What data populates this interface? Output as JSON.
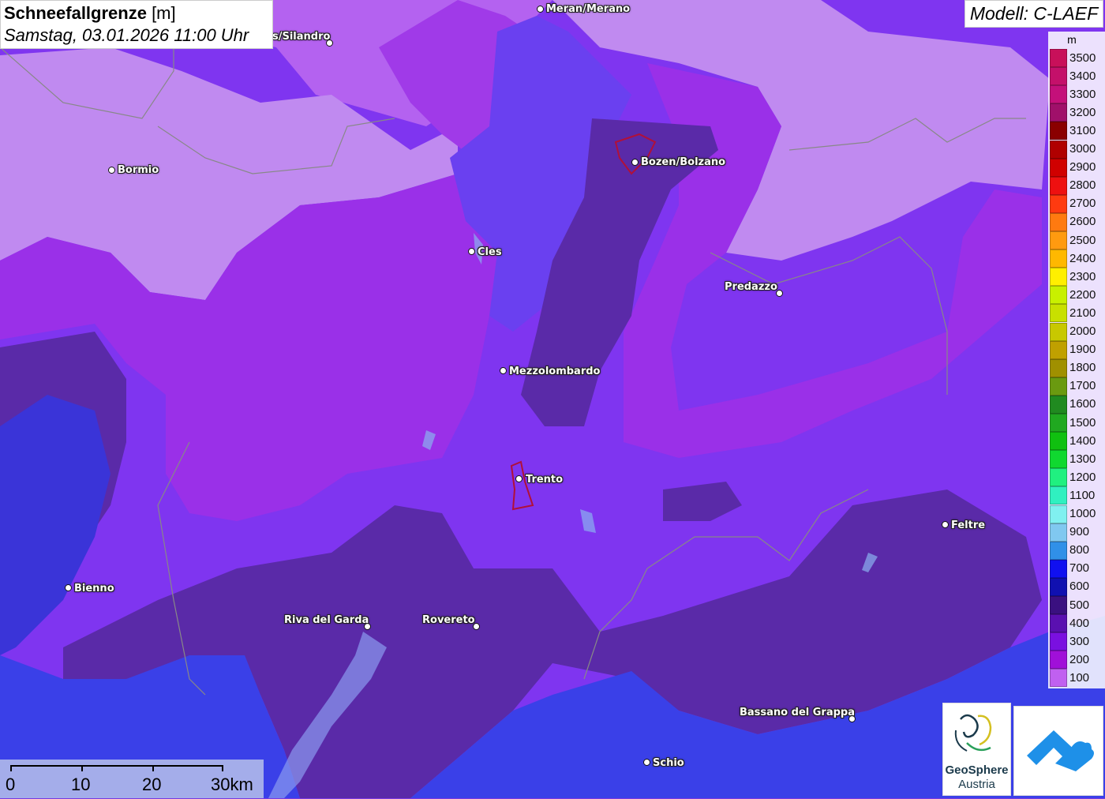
{
  "title": {
    "main": "Schneefallgrenze",
    "unit": " [m]",
    "date": "Samstag, 03.01.2026 11:00 Uhr"
  },
  "model": "Modell: C-LAEF",
  "legend": {
    "unit": "m",
    "items": [
      {
        "label": "3500",
        "color": "#c8105a"
      },
      {
        "label": "3400",
        "color": "#c4106a"
      },
      {
        "label": "3300",
        "color": "#c4107a"
      },
      {
        "label": "3200",
        "color": "#a0106a"
      },
      {
        "label": "3100",
        "color": "#8a0000"
      },
      {
        "label": "3000",
        "color": "#b00000"
      },
      {
        "label": "2900",
        "color": "#d00000"
      },
      {
        "label": "2800",
        "color": "#ee1010"
      },
      {
        "label": "2700",
        "color": "#ff3a10"
      },
      {
        "label": "2600",
        "color": "#ff7a10"
      },
      {
        "label": "2500",
        "color": "#ff9a10"
      },
      {
        "label": "2400",
        "color": "#ffb800"
      },
      {
        "label": "2300",
        "color": "#ffef00"
      },
      {
        "label": "2200",
        "color": "#c8f000"
      },
      {
        "label": "2100",
        "color": "#c8e000"
      },
      {
        "label": "2000",
        "color": "#c8c800"
      },
      {
        "label": "1900",
        "color": "#c0a000"
      },
      {
        "label": "1800",
        "color": "#a09000"
      },
      {
        "label": "1700",
        "color": "#6a9a10"
      },
      {
        "label": "1600",
        "color": "#208a20"
      },
      {
        "label": "1500",
        "color": "#20a820"
      },
      {
        "label": "1400",
        "color": "#10c010"
      },
      {
        "label": "1300",
        "color": "#10d830"
      },
      {
        "label": "1200",
        "color": "#20f080"
      },
      {
        "label": "1100",
        "color": "#30f0c0"
      },
      {
        "label": "1000",
        "color": "#80f0f0"
      },
      {
        "label": "900",
        "color": "#80c8f0"
      },
      {
        "label": "800",
        "color": "#3090e8"
      },
      {
        "label": "700",
        "color": "#1010f0"
      },
      {
        "label": "600",
        "color": "#1010b0"
      },
      {
        "label": "500",
        "color": "#3a1080"
      },
      {
        "label": "400",
        "color": "#5a10b0"
      },
      {
        "label": "300",
        "color": "#7a10e0"
      },
      {
        "label": "200",
        "color": "#a010d8"
      },
      {
        "label": "100",
        "color": "#c060f0"
      }
    ]
  },
  "cities": [
    {
      "name": "Meran/Merano"
    },
    {
      "name": "s/Silandro"
    },
    {
      "name": "Bormio"
    },
    {
      "name": "Bozen/Bolzano"
    },
    {
      "name": "Cles"
    },
    {
      "name": "Predazzo"
    },
    {
      "name": "Mezzolombardo"
    },
    {
      "name": "Trento"
    },
    {
      "name": "Feltre"
    },
    {
      "name": "Bienno"
    },
    {
      "name": "Riva del Garda"
    },
    {
      "name": "Rovereto"
    },
    {
      "name": "Bassano del Grappa"
    },
    {
      "name": "Schio"
    }
  ],
  "scalebar": {
    "labels": [
      "0",
      "10",
      "20",
      "30km"
    ]
  },
  "logos": {
    "geosphere_line1": "GeoSphere",
    "geosphere_line2": "Austria"
  }
}
